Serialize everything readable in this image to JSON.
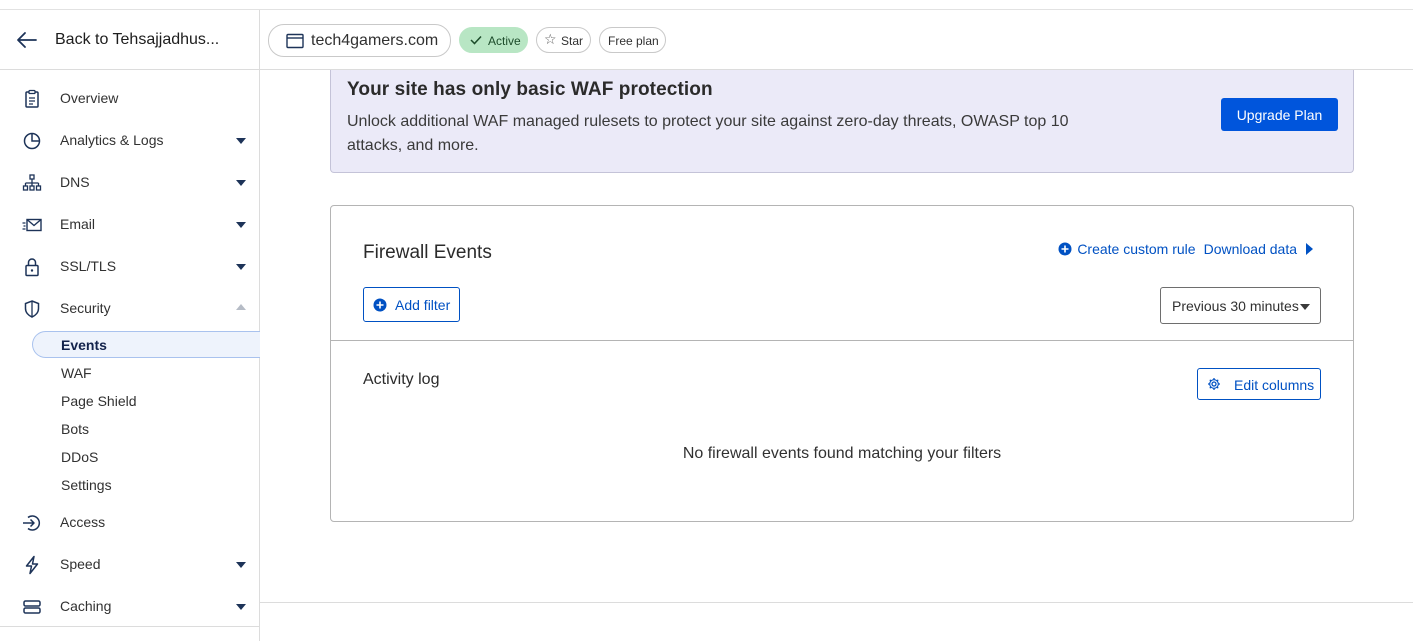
{
  "sidebar": {
    "back_label": "Back to Tehsajjadhus...",
    "items": [
      {
        "label": "Overview",
        "icon": "clipboard-icon",
        "caret": "none"
      },
      {
        "label": "Analytics & Logs",
        "icon": "pie-chart-icon",
        "caret": "down"
      },
      {
        "label": "DNS",
        "icon": "network-icon",
        "caret": "down"
      },
      {
        "label": "Email",
        "icon": "envelope-icon",
        "caret": "down"
      },
      {
        "label": "SSL/TLS",
        "icon": "lock-icon",
        "caret": "down"
      },
      {
        "label": "Security",
        "icon": "shield-icon",
        "caret": "up"
      },
      {
        "label": "Access",
        "icon": "access-icon",
        "caret": "none"
      },
      {
        "label": "Speed",
        "icon": "lightning-icon",
        "caret": "down"
      },
      {
        "label": "Caching",
        "icon": "storage-icon",
        "caret": "down"
      }
    ],
    "security_sub": [
      {
        "label": "Events",
        "active": true
      },
      {
        "label": "WAF",
        "active": false
      },
      {
        "label": "Page Shield",
        "active": false
      },
      {
        "label": "Bots",
        "active": false
      },
      {
        "label": "DDoS",
        "active": false
      },
      {
        "label": "Settings",
        "active": false
      }
    ]
  },
  "topbar": {
    "site": "tech4gamers.com",
    "status": "Active",
    "star": "Star",
    "plan": "Free plan"
  },
  "banner": {
    "title": "Your site has only basic WAF protection",
    "description": "Unlock additional WAF managed rulesets to protect your site against zero-day threats, OWASP top 10 attacks, and more.",
    "button": "Upgrade Plan"
  },
  "firewall": {
    "title": "Firewall Events",
    "create_rule": "Create custom rule",
    "download": "Download data",
    "add_filter": "Add filter",
    "time_range": "Previous 30 minutes",
    "activity_label": "Activity log",
    "edit_columns": "Edit columns",
    "empty_message": "No firewall events found matching your filters"
  },
  "colors": {
    "accent": "#0051c3",
    "primary_button": "#0055dc",
    "active_badge": "#b8e6c4",
    "banner_bg": "#ebeaf8",
    "sidebar_active_bg": "#eef3fc"
  }
}
